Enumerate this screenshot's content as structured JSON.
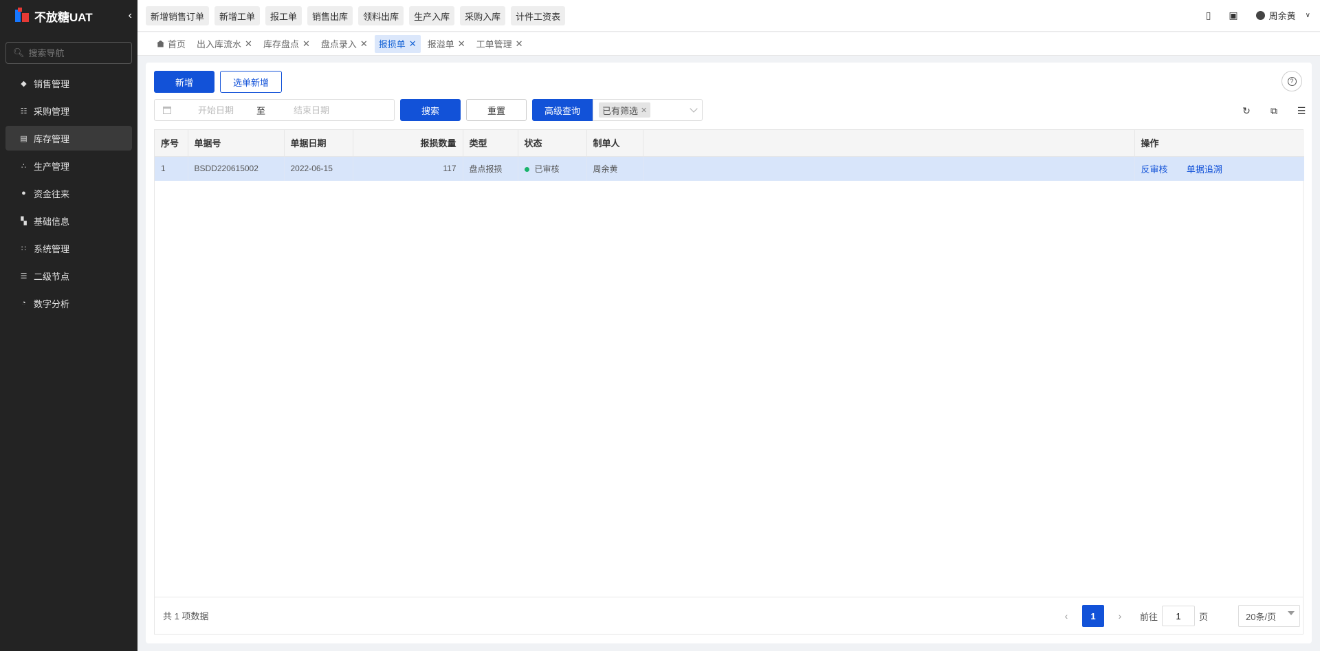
{
  "app": {
    "title": "不放糖UAT",
    "collapse_icon": "chevron-left-icon"
  },
  "sidebar": {
    "search_placeholder": "搜索导航",
    "items": [
      {
        "label": "销售管理",
        "icon": "tag-icon"
      },
      {
        "label": "采购管理",
        "icon": "cart-icon"
      },
      {
        "label": "库存管理",
        "icon": "warehouse-icon",
        "active": true
      },
      {
        "label": "生产管理",
        "icon": "production-icon"
      },
      {
        "label": "资金往来",
        "icon": "money-icon"
      },
      {
        "label": "基础信息",
        "icon": "grid-icon"
      },
      {
        "label": "系统管理",
        "icon": "apps-icon"
      },
      {
        "label": "二级节点",
        "icon": "document-icon"
      },
      {
        "label": "数字分析",
        "icon": "pie-icon"
      }
    ]
  },
  "topbar": {
    "quick_actions": [
      "新增销售订单",
      "新增工单",
      "报工单",
      "销售出库",
      "领料出库",
      "生产入库",
      "采购入库",
      "计件工资表"
    ],
    "user_name": "周余黄"
  },
  "tabs": [
    {
      "label": "首页",
      "closable": false
    },
    {
      "label": "出入库流水",
      "closable": true
    },
    {
      "label": "库存盘点",
      "closable": true
    },
    {
      "label": "盘点录入",
      "closable": true
    },
    {
      "label": "报损单",
      "closable": true,
      "active": true
    },
    {
      "label": "报溢单",
      "closable": true
    },
    {
      "label": "工单管理",
      "closable": true
    }
  ],
  "toolbar": {
    "add_label": "新增",
    "select_add_label": "选单新增",
    "start_date_placeholder": "开始日期",
    "range_separator": "至",
    "end_date_placeholder": "结束日期",
    "search_label": "搜索",
    "reset_label": "重置",
    "advanced_label": "高级查询",
    "filter_tag": "已有筛选"
  },
  "table": {
    "columns": [
      "序号",
      "单据号",
      "单据日期",
      "报损数量",
      "类型",
      "状态",
      "制单人",
      "",
      "操作"
    ],
    "rows": [
      {
        "index": "1",
        "doc_no": "BSDD220615002",
        "date": "2022-06-15",
        "qty": "117",
        "type": "盘点报损",
        "status": "已审核",
        "creator": "周余黄",
        "actions": [
          "反审核",
          "单据追溯"
        ]
      }
    ]
  },
  "pagination": {
    "total_text": "共 1 项数据",
    "current_page": "1",
    "goto_prefix": "前往",
    "goto_value": "1",
    "goto_suffix": "页",
    "page_size": "20条/页"
  },
  "colors": {
    "primary": "#1252d8",
    "sidebar_bg": "#232323",
    "row_selected": "#d8e5fa",
    "status_ok": "#19b36b"
  }
}
